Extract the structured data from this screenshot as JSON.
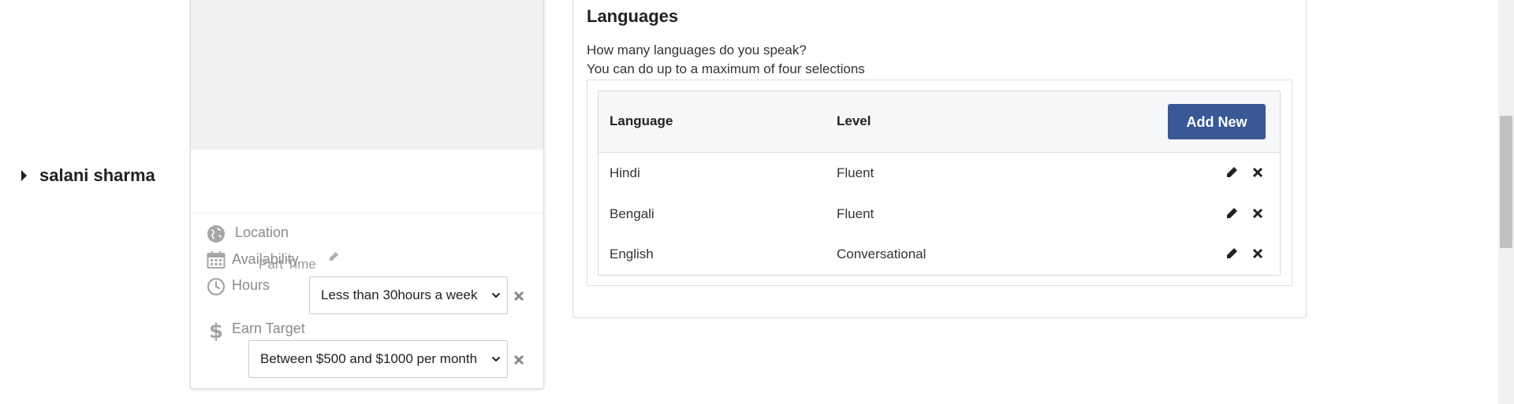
{
  "profile": {
    "name": "salani sharma",
    "location_label": "Location",
    "availability_label": "Availability",
    "availability_value": "Part Time",
    "hours_label": "Hours",
    "hours_selected": "Less than 30hours a week",
    "earn_target_label": "Earn Target",
    "earn_target_selected": "Between $500 and $1000 per month"
  },
  "languages": {
    "title": "Languages",
    "question": "How many languages do you speak?",
    "hint": "You can do up to a maximum of four selections",
    "col_language": "Language",
    "col_level": "Level",
    "add_button": "Add New",
    "rows": [
      {
        "language": "Hindi",
        "level": "Fluent"
      },
      {
        "language": "Bengali",
        "level": "Fluent"
      },
      {
        "language": "English",
        "level": "Conversational"
      }
    ]
  },
  "icons": [
    "caret-right-icon",
    "globe-icon",
    "calendar-icon",
    "clock-icon",
    "dollar-icon",
    "pencil-icon",
    "close-icon",
    "chevron-down-icon"
  ],
  "colors": {
    "accent": "#385896",
    "muted": "#8a8a8a"
  }
}
